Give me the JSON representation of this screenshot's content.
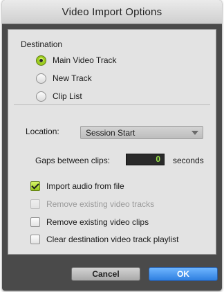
{
  "window": {
    "title": "Video Import Options"
  },
  "destination": {
    "heading": "Destination",
    "options": [
      {
        "label": "Main Video Track",
        "selected": true
      },
      {
        "label": "New Track",
        "selected": false
      },
      {
        "label": "Clip List",
        "selected": false
      }
    ]
  },
  "location": {
    "label": "Location:",
    "value": "Session Start"
  },
  "gaps": {
    "label": "Gaps between clips:",
    "value": "0",
    "unit": "seconds"
  },
  "checkboxes": [
    {
      "label": "Import audio from file",
      "checked": true,
      "enabled": true
    },
    {
      "label": "Remove existing video tracks",
      "checked": false,
      "enabled": false
    },
    {
      "label": "Remove existing video clips",
      "checked": false,
      "enabled": true
    },
    {
      "label": "Clear destination video track playlist",
      "checked": false,
      "enabled": true
    }
  ],
  "buttons": {
    "cancel": "Cancel",
    "ok": "OK"
  },
  "colors": {
    "accent_green": "#9ccc1f",
    "ok_blue": "#2f7fe0",
    "counter_text": "#9be64a"
  }
}
